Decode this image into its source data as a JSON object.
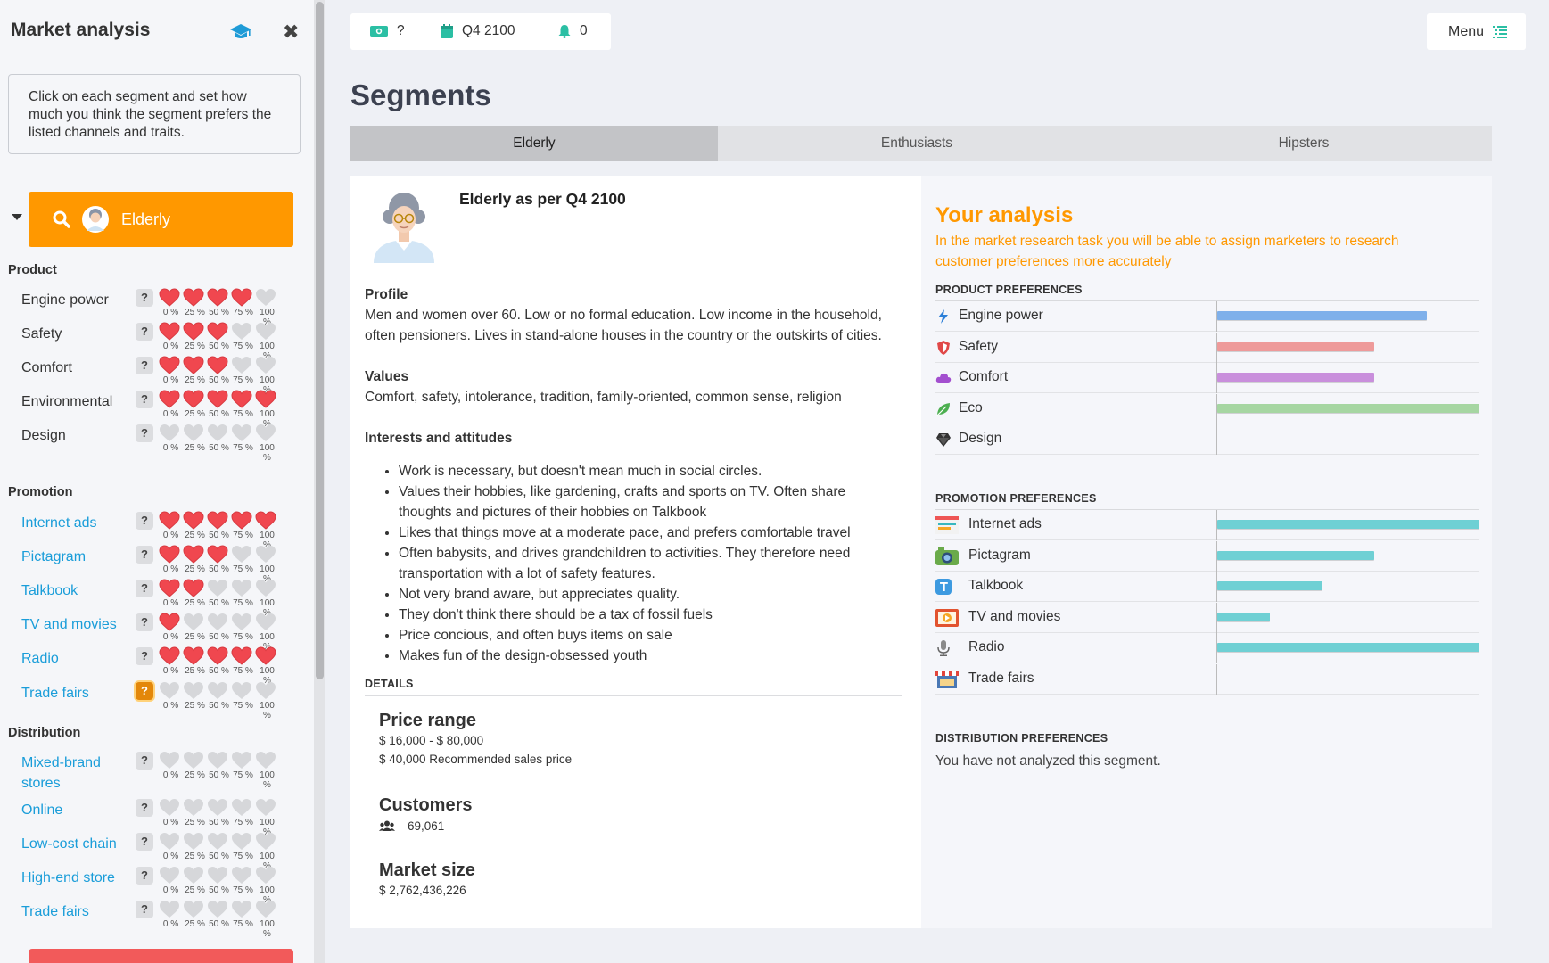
{
  "sidebar": {
    "title": "Market analysis",
    "instructions": "Click on each segment and set how much you think the segment prefers the listed channels and traits.",
    "selected_segment": "Elderly",
    "percent_labels": [
      "0 %",
      "25 %",
      "50 %",
      "75 %",
      "100 %"
    ],
    "sections": [
      {
        "title": "Product",
        "items": [
          {
            "label": "Engine power",
            "hearts": 4,
            "link": false,
            "active": false
          },
          {
            "label": "Safety",
            "hearts": 3,
            "link": false,
            "active": false
          },
          {
            "label": "Comfort",
            "hearts": 3,
            "link": false,
            "active": false
          },
          {
            "label": "Environmental",
            "hearts": 5,
            "link": false,
            "active": false
          },
          {
            "label": "Design",
            "hearts": 0,
            "link": false,
            "active": false
          }
        ]
      },
      {
        "title": "Promotion",
        "items": [
          {
            "label": "Internet ads",
            "hearts": 5,
            "link": true,
            "active": false
          },
          {
            "label": "Pictagram",
            "hearts": 3,
            "link": true,
            "active": false
          },
          {
            "label": "Talkbook",
            "hearts": 2,
            "link": true,
            "active": false
          },
          {
            "label": "TV and movies",
            "hearts": 1,
            "link": true,
            "active": false
          },
          {
            "label": "Radio",
            "hearts": 5,
            "link": true,
            "active": false
          },
          {
            "label": "Trade fairs",
            "hearts": 0,
            "link": true,
            "active": true
          }
        ]
      },
      {
        "title": "Distribution",
        "items": [
          {
            "label": "Mixed-brand stores",
            "hearts": 0,
            "link": true,
            "active": false
          },
          {
            "label": "Online",
            "hearts": 0,
            "link": true,
            "active": false
          },
          {
            "label": "Low-cost chain",
            "hearts": 0,
            "link": true,
            "active": false
          },
          {
            "label": "High-end store",
            "hearts": 0,
            "link": true,
            "active": false
          },
          {
            "label": "Trade fairs",
            "hearts": 0,
            "link": true,
            "active": false
          }
        ]
      }
    ]
  },
  "topbar": {
    "money": "?",
    "period": "Q4 2100",
    "notifications": "0",
    "menu_label": "Menu"
  },
  "page_title": "Segments",
  "tabs": [
    {
      "label": "Elderly",
      "active": true
    },
    {
      "label": "Enthusiasts",
      "active": false
    },
    {
      "label": "Hipsters",
      "active": false
    }
  ],
  "segment": {
    "heading": "Elderly as per Q4 2100",
    "profile_title": "Profile",
    "profile_text": "Men and women over 60. Low or no formal education. Low income in the household, often pensioners. Lives in stand-alone houses in the country or the outskirts of cities.",
    "values_title": "Values",
    "values_text": "Comfort, safety, intolerance, tradition, family-oriented, common sense, religion",
    "interests_title": "Interests and attitudes",
    "interests": [
      "Work is necessary, but doesn't mean much in social circles.",
      "Values their hobbies, like gardening, crafts and sports on TV. Often share thoughts and pictures of their hobbies on Talkbook",
      "Likes that things move at a moderate pace, and prefers comfortable travel",
      "Often babysits, and drives grandchildren to activities. They therefore need transportation with a lot of safety features.",
      "Not very brand aware, but appreciates quality.",
      "They don't think there should be a tax of fossil fuels",
      "Price concious, and often buys items on sale",
      "Makes fun of the design-obsessed youth"
    ],
    "details_label": "DETAILS",
    "price_range_title": "Price range",
    "price_range": "$ 16,000 - $ 80,000",
    "recommended_price": "$ 40,000 Recommended sales price",
    "customers_title": "Customers",
    "customers": "69,061",
    "market_size_title": "Market size",
    "market_size": "$ 2,762,436,226"
  },
  "analysis": {
    "title": "Your analysis",
    "subtitle": "In the market research task you will be able to assign marketers to research customer preferences more accurately",
    "product_head": "PRODUCT PREFERENCES",
    "product": [
      {
        "label": "Engine power",
        "icon": "bolt-icon",
        "value": 0.8,
        "color": "#7fb0ea"
      },
      {
        "label": "Safety",
        "icon": "shield-icon",
        "value": 0.6,
        "color": "#ee9a9a"
      },
      {
        "label": "Comfort",
        "icon": "cloud-icon",
        "value": 0.6,
        "color": "#c98fdc"
      },
      {
        "label": "Eco",
        "icon": "leaf-icon",
        "value": 1.0,
        "color": "#a6d6a2"
      },
      {
        "label": "Design",
        "icon": "diamond-icon",
        "value": 0,
        "color": "#cccccc"
      }
    ],
    "promotion_head": "PROMOTION PREFERENCES",
    "promotion": [
      {
        "label": "Internet ads",
        "icon": "internet-ads-icon",
        "value": 1.0,
        "color": "#6fd0d4"
      },
      {
        "label": "Pictagram",
        "icon": "camera-icon",
        "value": 0.6,
        "color": "#6fd0d4"
      },
      {
        "label": "Talkbook",
        "icon": "talkbook-icon",
        "value": 0.4,
        "color": "#6fd0d4"
      },
      {
        "label": "TV and movies",
        "icon": "tv-icon",
        "value": 0.2,
        "color": "#6fd0d4"
      },
      {
        "label": "Radio",
        "icon": "microphone-icon",
        "value": 1.0,
        "color": "#6fd0d4"
      },
      {
        "label": "Trade fairs",
        "icon": "stall-icon",
        "value": 0,
        "color": "#6fd0d4"
      }
    ],
    "distribution_head": "DISTRIBUTION PREFERENCES",
    "distribution_note": "You have not analyzed this segment."
  },
  "colors": {
    "accent": "#ff9800",
    "heart_on": "#f0474f",
    "heart_off": "#d6d7da",
    "link": "#1a9dd9"
  }
}
